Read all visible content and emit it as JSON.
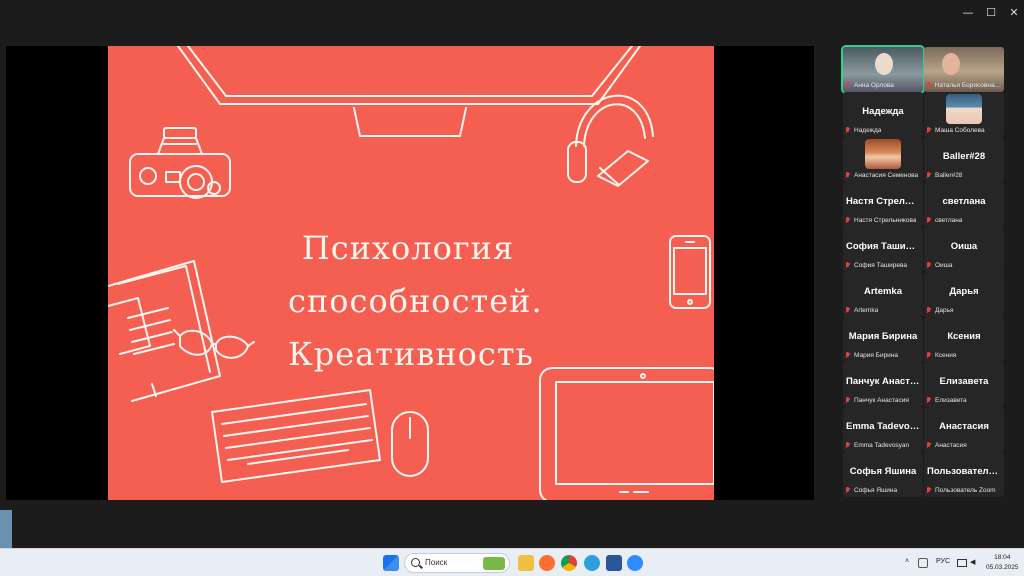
{
  "window": {
    "controls": {
      "minimize": "—",
      "maximize": "☐",
      "close": "✕"
    }
  },
  "slide": {
    "title_lines": [
      "Психология",
      "способностей.",
      "Креативность"
    ],
    "background": "#f45f52"
  },
  "gallery": {
    "tiles": [
      {
        "name": "",
        "label": "Анна Орлова",
        "video": true,
        "active": true
      },
      {
        "name": "",
        "label": "Наталья Борисовна Л...",
        "video": true,
        "active": false
      },
      {
        "name": "Надежда",
        "label": "Надежда",
        "video": false
      },
      {
        "name": "",
        "label": "Маша Соболева",
        "video": false,
        "avatar": "anime"
      },
      {
        "name": "",
        "label": "Анастасия Семенова",
        "video": false,
        "avatar": "photo"
      },
      {
        "name": "Baller#28",
        "label": "Baller#28",
        "video": false
      },
      {
        "name": "Настя Стрельн...",
        "label": "Настя Стрельникова",
        "video": false
      },
      {
        "name": "светлана",
        "label": "светлана",
        "video": false
      },
      {
        "name": "София Таширева",
        "label": "София Таширева",
        "video": false
      },
      {
        "name": "Оиша",
        "label": "Оиша",
        "video": false
      },
      {
        "name": "Artemka",
        "label": "Artemka",
        "video": false
      },
      {
        "name": "Дарья",
        "label": "Дарья",
        "video": false
      },
      {
        "name": "Мария Бирина",
        "label": "Мария Бирина",
        "video": false
      },
      {
        "name": "Ксения",
        "label": "Ксения",
        "video": false
      },
      {
        "name": "Панчук Анаста...",
        "label": "Панчук Анастасия",
        "video": false
      },
      {
        "name": "Елизавета",
        "label": "Елизавета",
        "video": false
      },
      {
        "name": "Emma Tadevosy...",
        "label": "Emma Tadevosyan",
        "video": false
      },
      {
        "name": "Анастасия",
        "label": "Анастасия",
        "video": false
      },
      {
        "name": "Софья Яшина",
        "label": "Софья Яшина",
        "video": false
      },
      {
        "name": "Пользователь...",
        "label": "Пользователь Zoom",
        "video": false
      }
    ]
  },
  "taskbar": {
    "search_placeholder": "Поиск",
    "lang": "РУС",
    "time": "18:04",
    "date": "05.03.2025"
  }
}
